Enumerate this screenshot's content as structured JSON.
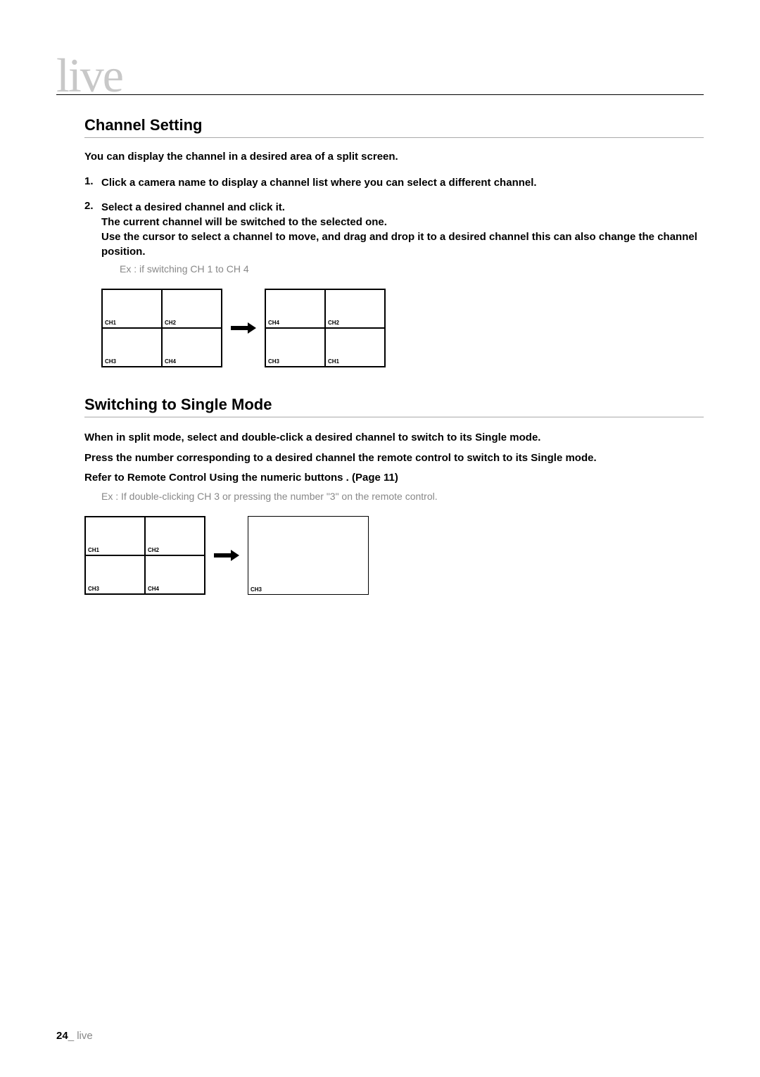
{
  "header": {
    "title": "live"
  },
  "sections": {
    "channel_setting": {
      "heading": "Channel Setting",
      "intro": "You can display the channel in a desired area of a split screen.",
      "steps": [
        {
          "num": "1.",
          "text": "Click a camera name to display a channel list where you can select a different channel."
        },
        {
          "num": "2.",
          "text_line1": "Select a desired channel and click it.",
          "text_line2": "The current channel will be switched to the selected one.",
          "text_line3": "Use the cursor to select a channel to move, and drag and drop it to a desired channel  this can also change the channel position.",
          "example": "Ex : if switching CH 1 to CH 4"
        }
      ],
      "diagram1": {
        "before": {
          "tl": "CH1",
          "tr": "CH2",
          "bl": "CH3",
          "br": "CH4"
        },
        "after": {
          "tl": "CH4",
          "tr": "CH2",
          "bl": "CH3",
          "br": "CH1"
        }
      }
    },
    "switching_single": {
      "heading": "Switching to Single Mode",
      "line1": "When in split mode, select and double-click a desired channel to switch to its Single mode.",
      "line2": "Press the number corresponding to a desired channel the remote control to switch to its Single mode.",
      "line3": "Refer to  Remote Control    Using the numeric buttons . (Page 11)",
      "example": "Ex : If double-clicking CH 3 or pressing the number \"3\" on the remote control.",
      "diagram": {
        "before": {
          "tl": "CH1",
          "tr": "CH2",
          "bl": "CH3",
          "br": "CH4"
        },
        "after_label": "CH3"
      }
    }
  },
  "footer": {
    "page_num": "24",
    "sep": "_",
    "label": " live"
  }
}
